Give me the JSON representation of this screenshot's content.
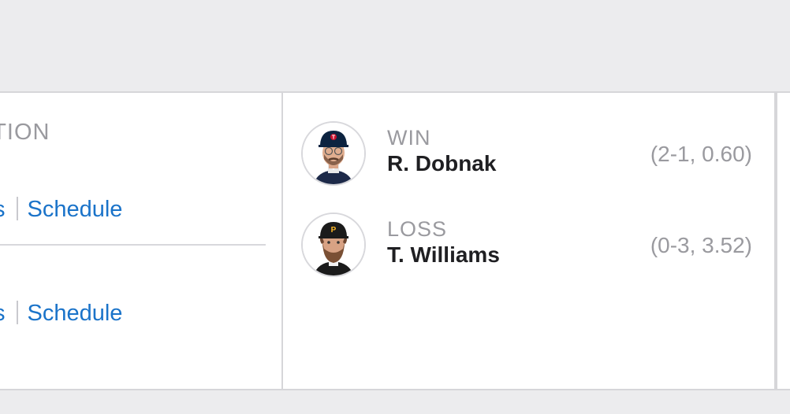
{
  "left_panel": {
    "header": "ATION",
    "rows": [
      {
        "link_prefix": "s",
        "link": "Schedule"
      },
      {
        "link_prefix": "s",
        "link": "Schedule"
      }
    ]
  },
  "decisions": {
    "win": {
      "label": "WIN",
      "name": "R. Dobnak",
      "record": "(2-1, 0.60)",
      "team_icon": "twins-logo-cap"
    },
    "loss": {
      "label": "LOSS",
      "name": "T. Williams",
      "record": "(0-3, 3.52)",
      "team_icon": "pirates-logo-cap"
    }
  },
  "colors": {
    "link": "#1a73c9",
    "muted": "#9a9a9f",
    "text": "#1f1f22",
    "border": "#d6d6d9"
  }
}
